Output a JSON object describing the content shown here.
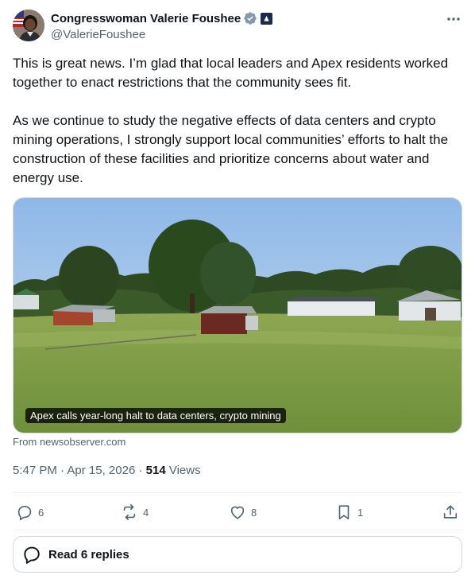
{
  "author": {
    "display_name": "Congresswoman Valerie Foushee",
    "handle": "@ValerieFoushee"
  },
  "tweet": {
    "paragraphs": [
      "This is great news. I’m glad that local leaders and Apex residents worked together to enact restrictions that the community sees fit.",
      "As we continue to study the negative effects of data centers and crypto mining operations, I strongly support local communities’ efforts to halt the construction of these facilities and prioritize concerns about water and energy use."
    ]
  },
  "link_card": {
    "caption": "Apex calls year-long halt to data centers, crypto mining",
    "source": "From newsobserver.com"
  },
  "meta": {
    "time": "5:47 PM",
    "separator1": " · ",
    "date": "Apr 15, 2026",
    "separator2": " · ",
    "views_count": "514",
    "views_label": " Views"
  },
  "actions": {
    "replies": "6",
    "reposts": "4",
    "likes": "8",
    "bookmarks": "1"
  },
  "read_replies": {
    "label": "Read 6 replies"
  },
  "icons": {
    "verified": "verified-badge-icon",
    "affiliation": "government-affiliation-icon",
    "more": "more-horizontal-icon",
    "reply": "reply-icon",
    "repost": "repost-icon",
    "like": "heart-icon",
    "bookmark": "bookmark-icon",
    "share": "share-icon"
  },
  "colors": {
    "text_primary": "#0f1419",
    "text_secondary": "#536471",
    "border": "#cfd9de",
    "verified": "#829aab"
  }
}
